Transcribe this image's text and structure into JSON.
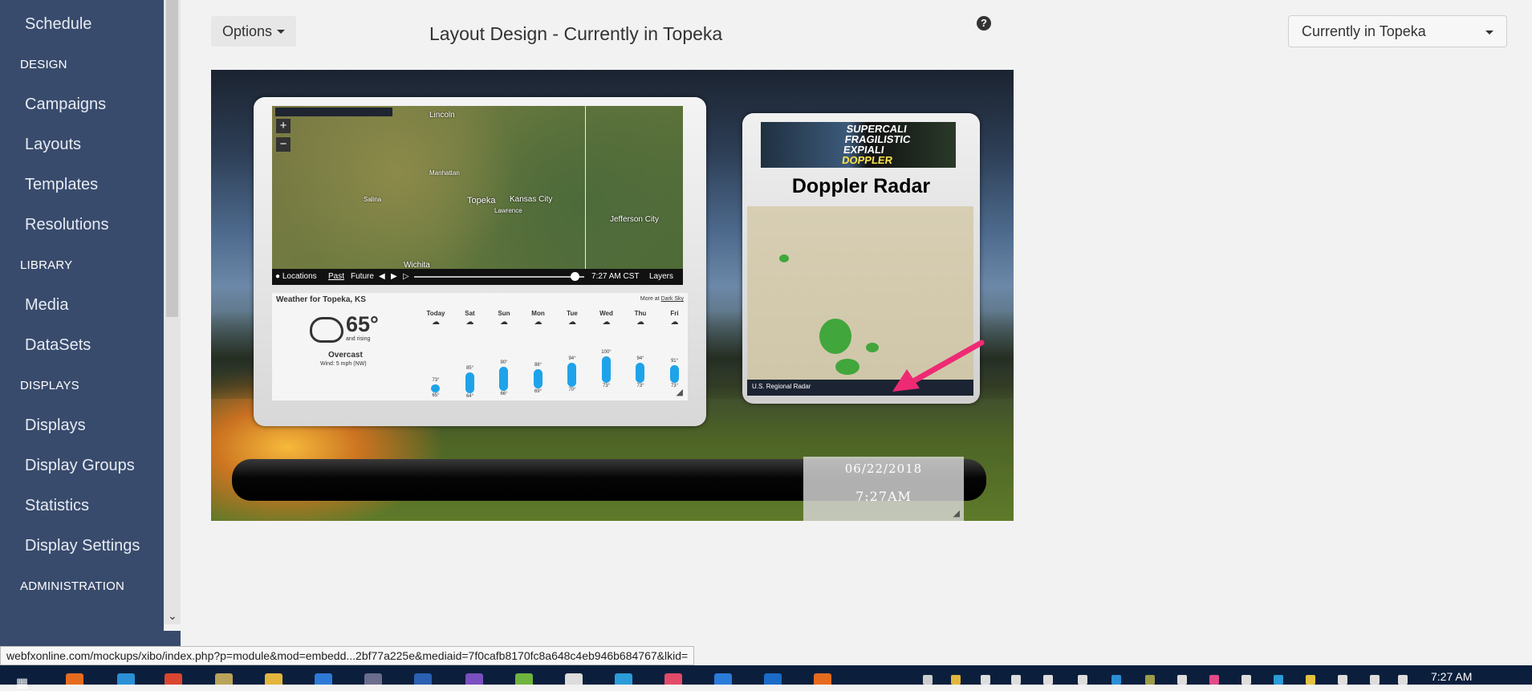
{
  "sidebar": {
    "items": [
      {
        "label": "Schedule"
      },
      {
        "heading": "DESIGN"
      },
      {
        "label": "Campaigns"
      },
      {
        "label": "Layouts"
      },
      {
        "label": "Templates"
      },
      {
        "label": "Resolutions"
      },
      {
        "heading": "LIBRARY"
      },
      {
        "label": "Media"
      },
      {
        "label": "DataSets"
      },
      {
        "heading": "DISPLAYS"
      },
      {
        "label": "Displays"
      },
      {
        "label": "Display Groups"
      },
      {
        "label": "Statistics"
      },
      {
        "label": "Display Settings"
      },
      {
        "heading": "ADMINISTRATION"
      }
    ]
  },
  "header": {
    "options_label": "Options",
    "title": "Layout Design - Currently in Topeka",
    "help_glyph": "?",
    "display_select_value": "Currently in Topeka"
  },
  "preview": {
    "map": {
      "cities": [
        "Lincoln",
        "Topeka",
        "Kansas City",
        "Jefferson City",
        "Wichita",
        "Manhattan",
        "Lawrence",
        "Salina"
      ],
      "controls": {
        "locations": "Locations",
        "past": "Past",
        "future": "Future",
        "time": "7:27 AM CST",
        "layers": "Layers"
      }
    },
    "weather": {
      "heading": "Weather for Topeka, KS",
      "more_prefix": "More at ",
      "more_link": "Dark Sky",
      "temp": "65°",
      "trend": "and rising",
      "condition": "Overcast",
      "wind": "Wind: 5 mph (NW)",
      "days": [
        {
          "name": "Today",
          "hi": "73°",
          "lo": "65°",
          "bar_top": 0.7,
          "bar_bottom": 0.9
        },
        {
          "name": "Sat",
          "hi": "85°",
          "lo": "64°",
          "bar_top": 0.4,
          "bar_bottom": 0.92
        },
        {
          "name": "Sun",
          "hi": "90°",
          "lo": "66°",
          "bar_top": 0.25,
          "bar_bottom": 0.85
        },
        {
          "name": "Mon",
          "hi": "88°",
          "lo": "69°",
          "bar_top": 0.32,
          "bar_bottom": 0.8
        },
        {
          "name": "Tue",
          "hi": "94°",
          "lo": "70°",
          "bar_top": 0.15,
          "bar_bottom": 0.75
        },
        {
          "name": "Wed",
          "hi": "100°",
          "lo": "73°",
          "bar_top": 0.0,
          "bar_bottom": 0.66
        },
        {
          "name": "Thu",
          "hi": "94°",
          "lo": "73°",
          "bar_top": 0.15,
          "bar_bottom": 0.66
        },
        {
          "name": "Fri",
          "hi": "91°",
          "lo": "73°",
          "bar_top": 0.22,
          "bar_bottom": 0.66
        }
      ]
    },
    "radar": {
      "banner_line1": "SUPERCALI",
      "banner_line2": "FRAGILISTIC",
      "banner_line3": "EXPIALI",
      "banner_line4": "DOPPLER",
      "title": "Doppler Radar",
      "footer": "U.S. Regional Radar"
    },
    "clock": {
      "date": "06/22/2018",
      "time": "7:27AM"
    }
  },
  "status_url": "webfxonline.com/mockups/xibo/index.php?p=module&mod=embedd...2bf77a225e&mediaid=7f0cafb8170fc8a648c4eb946b684767&lkid=",
  "taskbar": {
    "clock": "7:27 AM"
  },
  "colors": {
    "sidebar": "#394b6c",
    "accent_arrow": "#ee2a74",
    "forecast_bar": "#1ea3ea",
    "taskbar": "#0b1f3d"
  }
}
